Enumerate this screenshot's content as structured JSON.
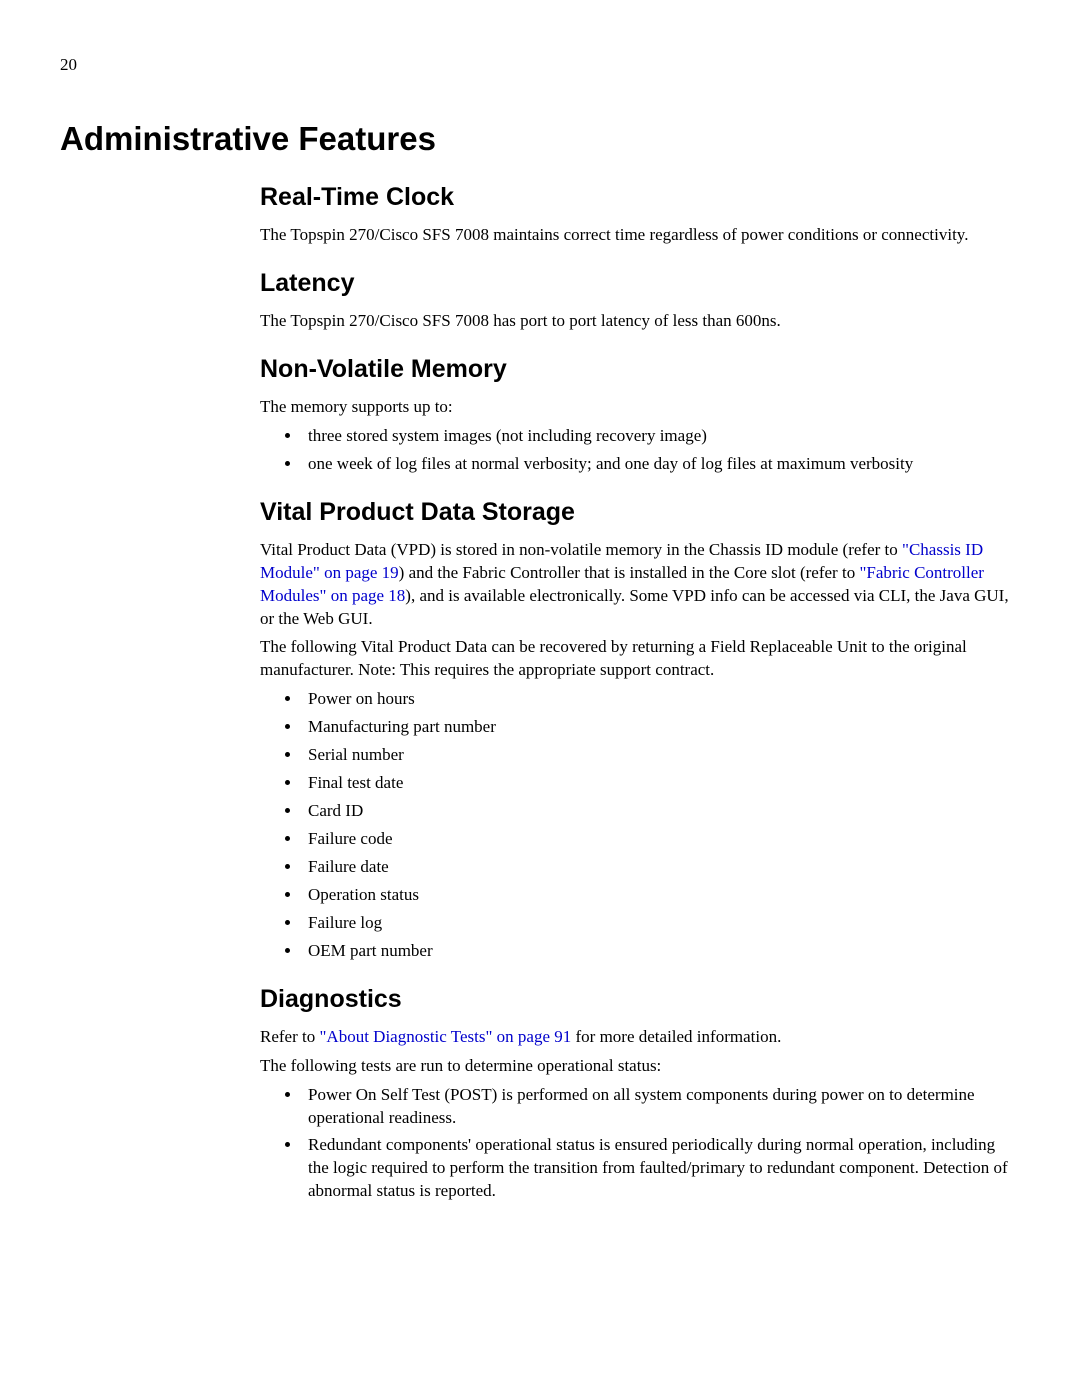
{
  "page_number": "20",
  "h1": "Administrative Features",
  "sections": {
    "rtc": {
      "title": "Real-Time Clock",
      "p1": "The Topspin 270/Cisco SFS 7008 maintains correct time regardless of power conditions or connectivity."
    },
    "latency": {
      "title": "Latency",
      "p1": "The Topspin 270/Cisco SFS 7008 has port to port latency of less than 600ns."
    },
    "nvm": {
      "title": "Non-Volatile Memory",
      "p1": "The memory supports up to:",
      "li1": "three stored system images (not including recovery image)",
      "li2": "one week of log files at normal verbosity; and one day of log files at maximum verbosity"
    },
    "vpd": {
      "title": "Vital Product Data Storage",
      "p1a": "Vital Product Data (VPD) is stored in non-volatile memory in the Chassis ID module (refer to ",
      "link1": "\"Chassis ID Module\" on page 19",
      "p1b": ") and the Fabric Controller that is installed in the Core slot (refer to ",
      "link2": "\"Fabric Controller Modules\" on page 18",
      "p1c": "), and is available electronically. Some VPD info can be accessed via CLI, the Java GUI, or the Web GUI.",
      "p2": "The following Vital Product Data can be recovered by returning a Field Replaceable Unit to the original manufacturer. Note: This requires the appropriate support contract.",
      "li1": "Power on hours",
      "li2": "Manufacturing part number",
      "li3": "Serial number",
      "li4": "Final test date",
      "li5": "Card ID",
      "li6": "Failure code",
      "li7": "Failure date",
      "li8": "Operation status",
      "li9": "Failure log",
      "li10": "OEM part number"
    },
    "diag": {
      "title": "Diagnostics",
      "p1a": "Refer to ",
      "link1": "\"About Diagnostic Tests\" on page 91",
      "p1b": " for more detailed information.",
      "p2": "The following tests are run to determine operational status:",
      "li1": "Power On Self Test (POST) is performed on all system components during power on to determine operational readiness.",
      "li2": "Redundant components' operational status is ensured periodically during normal operation, including the logic required to perform the transition from faulted/primary to redundant component. Detection of abnormal status is reported."
    }
  }
}
